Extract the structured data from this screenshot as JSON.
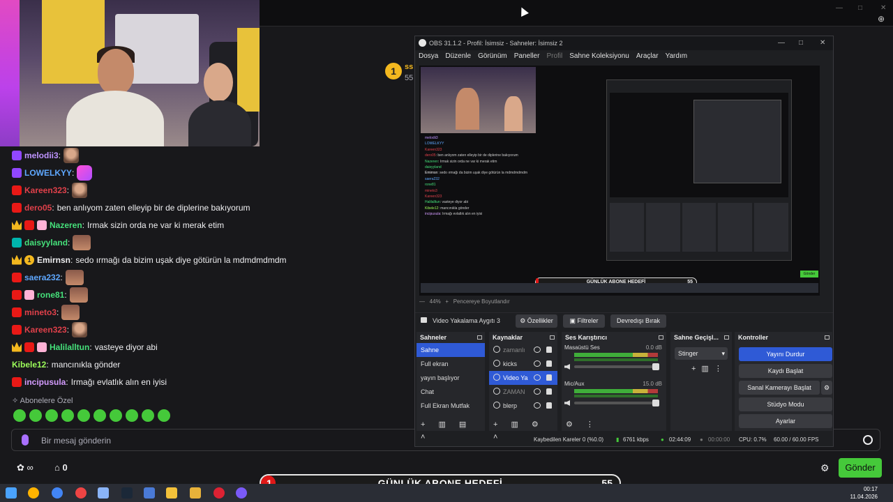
{
  "topbar": {
    "zoom_icon": "zoom-icon"
  },
  "pinned": {
    "badge": "1",
    "title": "ss",
    "count": "55"
  },
  "chat": {
    "messages": [
      {
        "badges": [
          "twitch"
        ],
        "user": "melodii3",
        "color": "#bf94ff",
        "text": "",
        "emotes": [
          "face"
        ]
      },
      {
        "badges": [
          "twitch"
        ],
        "user": "LOWELKYY",
        "color": "#5fa8ff",
        "text": "",
        "emotes": [
          "slay"
        ]
      },
      {
        "badges": [
          "mod"
        ],
        "user": "Kareen323",
        "color": "#e0404a",
        "text": "",
        "emotes": [
          "face"
        ]
      },
      {
        "badges": [
          "mod"
        ],
        "user": "dero05",
        "color": "#e0404a",
        "text": "ben anlıyom zaten elleyip bir de diplerine bakıyorum",
        "emotes": []
      },
      {
        "badges": [
          "crown",
          "mod",
          "gift"
        ],
        "user": "Nazeren",
        "color": "#45e07a",
        "text": "Irmak sizin orda ne var ki merak etim",
        "emotes": []
      },
      {
        "badges": [
          "teal"
        ],
        "user": "daisyyland",
        "color": "#45e07a",
        "text": "",
        "emotes": [
          "face2"
        ]
      },
      {
        "badges": [
          "crown",
          "sub1"
        ],
        "user": "Emirnsn",
        "color": "#efeff1",
        "text": "sedo ırmağı da bizim uşak diye götürün la mdmdmdmdm",
        "emotes": []
      },
      {
        "badges": [
          "mod"
        ],
        "user": "saera232",
        "color": "#5fa8ff",
        "text": "",
        "emotes": [
          "face2"
        ]
      },
      {
        "badges": [
          "mod",
          "gift"
        ],
        "user": "rone81",
        "color": "#45e07a",
        "text": "",
        "emotes": [
          "face2"
        ]
      },
      {
        "badges": [
          "mod"
        ],
        "user": "mineto3",
        "color": "#e0404a",
        "text": "",
        "emotes": [
          "face2"
        ]
      },
      {
        "badges": [
          "mod"
        ],
        "user": "Kareen323",
        "color": "#e0404a",
        "text": "",
        "emotes": [
          "face"
        ]
      },
      {
        "badges": [
          "crown",
          "mod",
          "gift"
        ],
        "user": "Halilalltun",
        "color": "#45e07a",
        "text": "vasteye diyor abi",
        "emotes": []
      },
      {
        "badges": [],
        "user": "Kibele12",
        "color": "#9dff5a",
        "text": "mancınıkla gönder",
        "emotes": []
      },
      {
        "badges": [
          "mod"
        ],
        "user": "incipusula",
        "color": "#d49cff",
        "text": "Irmağı evlatlık alın en iyisi",
        "emotes": []
      }
    ],
    "sub_only": "Abonelere Özel",
    "input_placeholder": "Bir mesaj gönderin",
    "points": "∞",
    "gift_count": "0",
    "send_label": "Gönder"
  },
  "goal": {
    "left": "1",
    "label": "GÜNLÜK ABONE HEDEFİ",
    "right": "55",
    "progress": 0.02
  },
  "taskbar": {
    "time": "00:17",
    "date": "11.04.2026"
  },
  "obs": {
    "title": "OBS 31.1.2 - Profil: İsimsiz - Sahneler: İsimsiz 2",
    "menu": [
      "Dosya",
      "Düzenle",
      "Görünüm",
      "Paneller",
      "Profil",
      "Sahne Koleksiyonu",
      "Araçlar",
      "Yardım"
    ],
    "zoom": "44%",
    "fit_label": "Pencereye Boyutlandır",
    "preview_goal": {
      "label": "GÜNLÜK ABONE HEDEFİ",
      "right": "55"
    },
    "preview_send": "Gönder",
    "source_bar": {
      "name": "Video Yakalama Aygıtı 3",
      "properties": "Özellikler",
      "filters": "Filtreler",
      "deactivate": "Devredışı Bırak"
    },
    "scenes": {
      "title": "Sahneler",
      "items": [
        "Sahne",
        "Full ekran",
        "yayın başlıyor",
        "Chat",
        "Full Ekran Mutfak"
      ]
    },
    "sources": {
      "title": "Kaynaklar",
      "items": [
        "zamanlı",
        "kicks",
        "Video Ya",
        "ZAMAN",
        "blerp"
      ]
    },
    "mixer": {
      "title": "Ses Karıştırıcı",
      "channels": [
        {
          "name": "Masaüstü Ses",
          "db": "0.0 dB"
        },
        {
          "name": "Mic/Aux",
          "db": "15.0 dB"
        }
      ]
    },
    "transitions": {
      "title": "Sahne Geçişl...",
      "selected": "Stinger"
    },
    "controls": {
      "title": "Kontroller",
      "buttons": [
        "Yayını Durdur",
        "Kaydı Başlat",
        "Sanal Kamerayı Başlat",
        "Stüdyo Modu",
        "Ayarlar"
      ]
    },
    "status": {
      "dropped": "Kaybedilen Kareler 0 (%0.0)",
      "bitrate": "6761 kbps",
      "live_time": "02:44:09",
      "rec_time": "00:00:00",
      "cpu": "CPU: 0.7%",
      "fps": "60.00 / 60.00 FPS"
    }
  }
}
